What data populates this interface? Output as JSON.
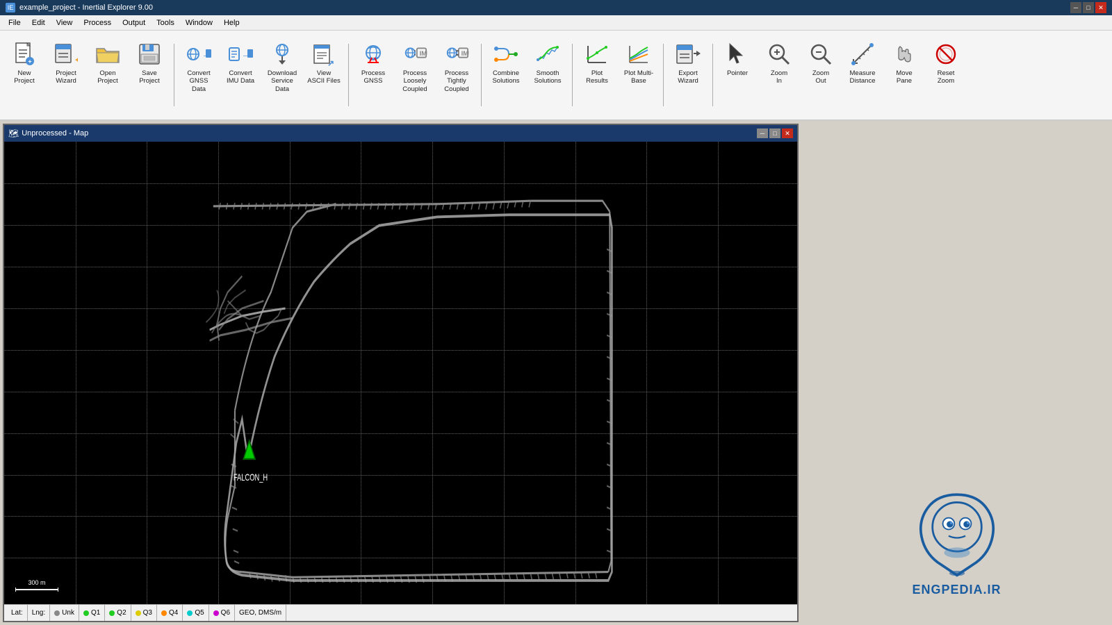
{
  "app": {
    "title": "example_project - Inertial Explorer 9.00"
  },
  "menu": {
    "items": [
      "File",
      "Edit",
      "View",
      "Process",
      "Output",
      "Tools",
      "Window",
      "Help"
    ]
  },
  "toolbar": {
    "buttons": [
      {
        "id": "new-project",
        "label": "New\nProject",
        "icon": "📄"
      },
      {
        "id": "project-wizard",
        "label": "Project\nWizard",
        "icon": "🧙"
      },
      {
        "id": "open-project",
        "label": "Open\nProject",
        "icon": "📂"
      },
      {
        "id": "save-project",
        "label": "Save\nProject",
        "icon": "💾"
      },
      {
        "id": "convert-gnss",
        "label": "Convert\nGNSS\nData",
        "icon": "🔄"
      },
      {
        "id": "convert-imu",
        "label": "Convert\nIMU Data",
        "icon": "🔄"
      },
      {
        "id": "download-service",
        "label": "Download\nService\nData",
        "icon": "⬇️"
      },
      {
        "id": "view-ascii",
        "label": "View\nASCII Files",
        "icon": "📋"
      },
      {
        "id": "process-gnss",
        "label": "Process\nGNSS",
        "icon": "⚙️"
      },
      {
        "id": "process-loosely",
        "label": "Process\nLoosely\nCoupled",
        "icon": "⚙️"
      },
      {
        "id": "process-tightly",
        "label": "Process\nTightly\nCoupled",
        "icon": "⚙️"
      },
      {
        "id": "combine-solutions",
        "label": "Combine\nSolutions",
        "icon": "🔀"
      },
      {
        "id": "smooth-solutions",
        "label": "Smooth\nSolutions",
        "icon": "📈"
      },
      {
        "id": "plot-results",
        "label": "Plot\nResults",
        "icon": "📊"
      },
      {
        "id": "plot-multi-base",
        "label": "Plot Multi-\nBase",
        "icon": "📊"
      },
      {
        "id": "export-wizard",
        "label": "Export\nWizard",
        "icon": "📤"
      },
      {
        "id": "pointer",
        "label": "Pointer",
        "icon": "↖"
      },
      {
        "id": "zoom-in",
        "label": "Zoom\nIn",
        "icon": "🔍"
      },
      {
        "id": "zoom-out",
        "label": "Zoom\nOut",
        "icon": "🔍"
      },
      {
        "id": "measure-distance",
        "label": "Measure\nDistance",
        "icon": "📏"
      },
      {
        "id": "move-pane",
        "label": "Move\nPane",
        "icon": "✋"
      },
      {
        "id": "reset-zoom",
        "label": "Reset\nZoom",
        "icon": "⊘"
      }
    ]
  },
  "map_window": {
    "title": "Unprocessed - Map",
    "falcon_label": "FALCON_H"
  },
  "statusbar": {
    "lat_label": "Lat:",
    "lng_label": "Lng:",
    "unk_label": "Unk",
    "q1_label": "Q1",
    "q2_label": "Q2",
    "q3_label": "Q3",
    "q4_label": "Q4",
    "q5_label": "Q5",
    "q6_label": "Q6",
    "coord_label": "GEO, DMS/m"
  },
  "scale_bar": {
    "label": "300 m"
  },
  "watermark": {
    "text": "ENGPEDIA.IR"
  }
}
